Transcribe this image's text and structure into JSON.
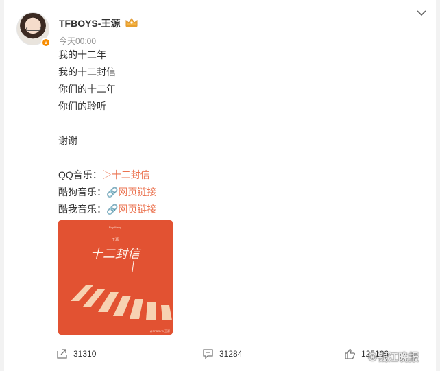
{
  "post": {
    "author": "TFBOYS-王源",
    "time": "今天00:00",
    "lines": [
      "我的十二年",
      "我的十二封信",
      "你们的十二年",
      "你们的聆听",
      "谢谢"
    ],
    "music": [
      {
        "label": "QQ音乐：",
        "link": "▷十二封信"
      },
      {
        "label": "酷狗音乐：",
        "link": "🔗网页链接"
      },
      {
        "label": "酷我音乐：",
        "link": "🔗网页链接"
      }
    ],
    "cover": {
      "top_text": "Roy Wang",
      "small_text": "王源",
      "title": "十二封信",
      "watermark": "@TFBOYS-王源"
    }
  },
  "footer": {
    "repost_count": "31310",
    "comment_count": "31284",
    "like_count": "125106"
  },
  "watermark": "⊗钱江晚报",
  "colors": {
    "accent": "#eb7350",
    "cover_bg": "#e25232",
    "verified": "#f78c00"
  }
}
